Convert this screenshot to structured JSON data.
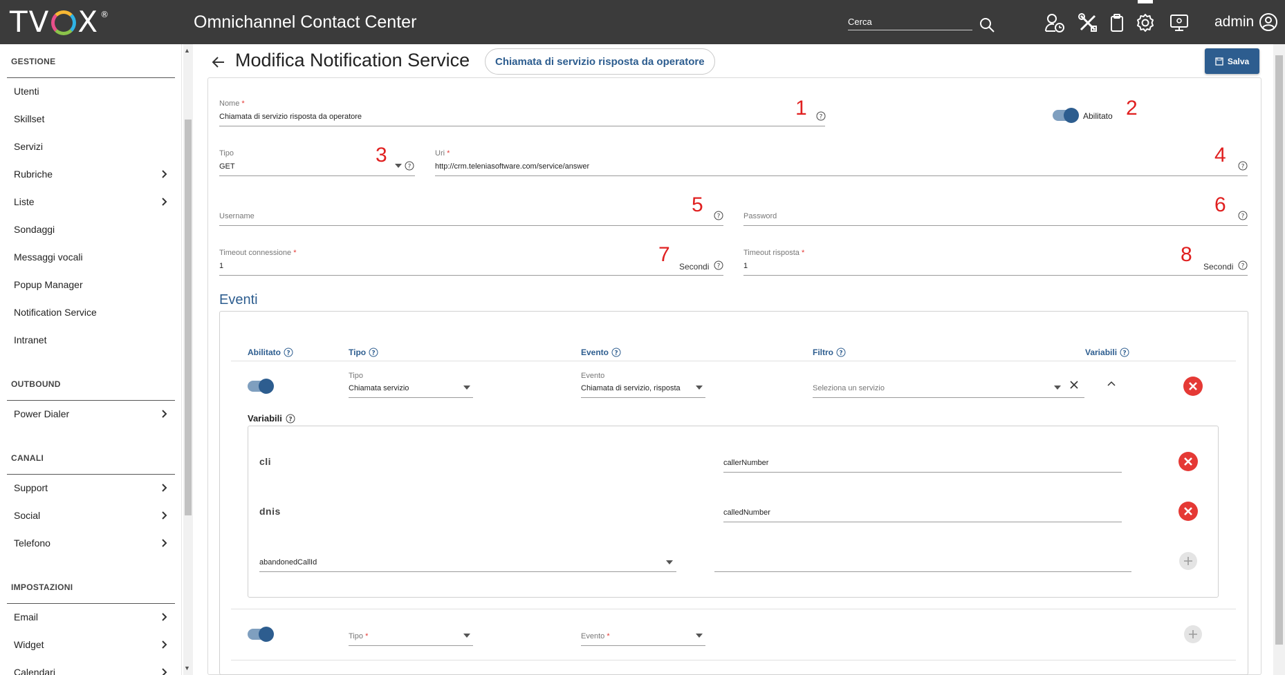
{
  "header": {
    "logo_text": "TVOX",
    "app_title": "Omnichannel Contact Center",
    "search_placeholder": "Cerca",
    "user": "admin",
    "icons": [
      "agent-clock-icon",
      "tools-icon",
      "clipboard-icon",
      "gear-icon",
      "monitor-icon",
      "user-circle-icon"
    ]
  },
  "sidebar": {
    "sections": [
      {
        "title": "GESTIONE",
        "items": [
          {
            "label": "Utenti",
            "has_arrow": false
          },
          {
            "label": "Skillset",
            "has_arrow": false
          },
          {
            "label": "Servizi",
            "has_arrow": false
          },
          {
            "label": "Rubriche",
            "has_arrow": true
          },
          {
            "label": "Liste",
            "has_arrow": true
          },
          {
            "label": "Sondaggi",
            "has_arrow": false
          },
          {
            "label": "Messaggi vocali",
            "has_arrow": false
          },
          {
            "label": "Popup Manager",
            "has_arrow": false
          },
          {
            "label": "Notification Service",
            "has_arrow": false
          },
          {
            "label": "Intranet",
            "has_arrow": false
          }
        ]
      },
      {
        "title": "OUTBOUND",
        "items": [
          {
            "label": "Power Dialer",
            "has_arrow": true
          }
        ]
      },
      {
        "title": "CANALI",
        "items": [
          {
            "label": "Support",
            "has_arrow": true
          },
          {
            "label": "Social",
            "has_arrow": true
          },
          {
            "label": "Telefono",
            "has_arrow": true
          }
        ]
      },
      {
        "title": "IMPOSTAZIONI",
        "items": [
          {
            "label": "Email",
            "has_arrow": true
          },
          {
            "label": "Widget",
            "has_arrow": true
          },
          {
            "label": "Calendari",
            "has_arrow": true
          }
        ]
      }
    ]
  },
  "page": {
    "title": "Modifica Notification Service",
    "chip": "Chiamata di servizio risposta da operatore",
    "save_label": "Salva"
  },
  "form": {
    "nome": {
      "label": "Nome",
      "value": "Chiamata di servizio risposta da operatore",
      "marker": "1"
    },
    "abilitato": {
      "label": "Abilitato",
      "on": true,
      "marker": "2"
    },
    "tipo": {
      "label": "Tipo",
      "value": "GET",
      "marker": "3"
    },
    "uri": {
      "label": "Uri",
      "value": "http://crm.teleniasoftware.com/service/answer",
      "marker": "4"
    },
    "username": {
      "label": "Username",
      "value": "",
      "marker": "5"
    },
    "password": {
      "label": "Password",
      "value": "",
      "marker": "6"
    },
    "timeout_connessione": {
      "label": "Timeout connessione",
      "value": "1",
      "unit": "Secondi",
      "marker": "7"
    },
    "timeout_risposta": {
      "label": "Timeout risposta",
      "value": "1",
      "unit": "Secondi",
      "marker": "8"
    }
  },
  "eventi": {
    "title": "Eventi",
    "columns": [
      "Abilitato",
      "Tipo",
      "Evento",
      "Filtro",
      "Variabili"
    ],
    "row1": {
      "enabled": true,
      "tipo_label": "Tipo",
      "tipo_value": "Chiamata servizio",
      "evento_label": "Evento",
      "evento_value": "Chiamata di servizio, risposta",
      "filtro_placeholder": "Seleziona un servizio"
    },
    "variabili": {
      "label": "Variabili",
      "rows": [
        {
          "name": "cli",
          "value": "callerNumber"
        },
        {
          "name": "dnis",
          "value": "calledNumber"
        }
      ],
      "new_select": "abandonedCallId",
      "new_value": ""
    },
    "row2": {
      "enabled": true,
      "tipo_label": "Tipo",
      "evento_label": "Evento"
    }
  },
  "colors": {
    "topbar": "#3b3b3b",
    "accent": "#2d5d8f",
    "danger": "#e53935",
    "marker": "#e02020"
  }
}
